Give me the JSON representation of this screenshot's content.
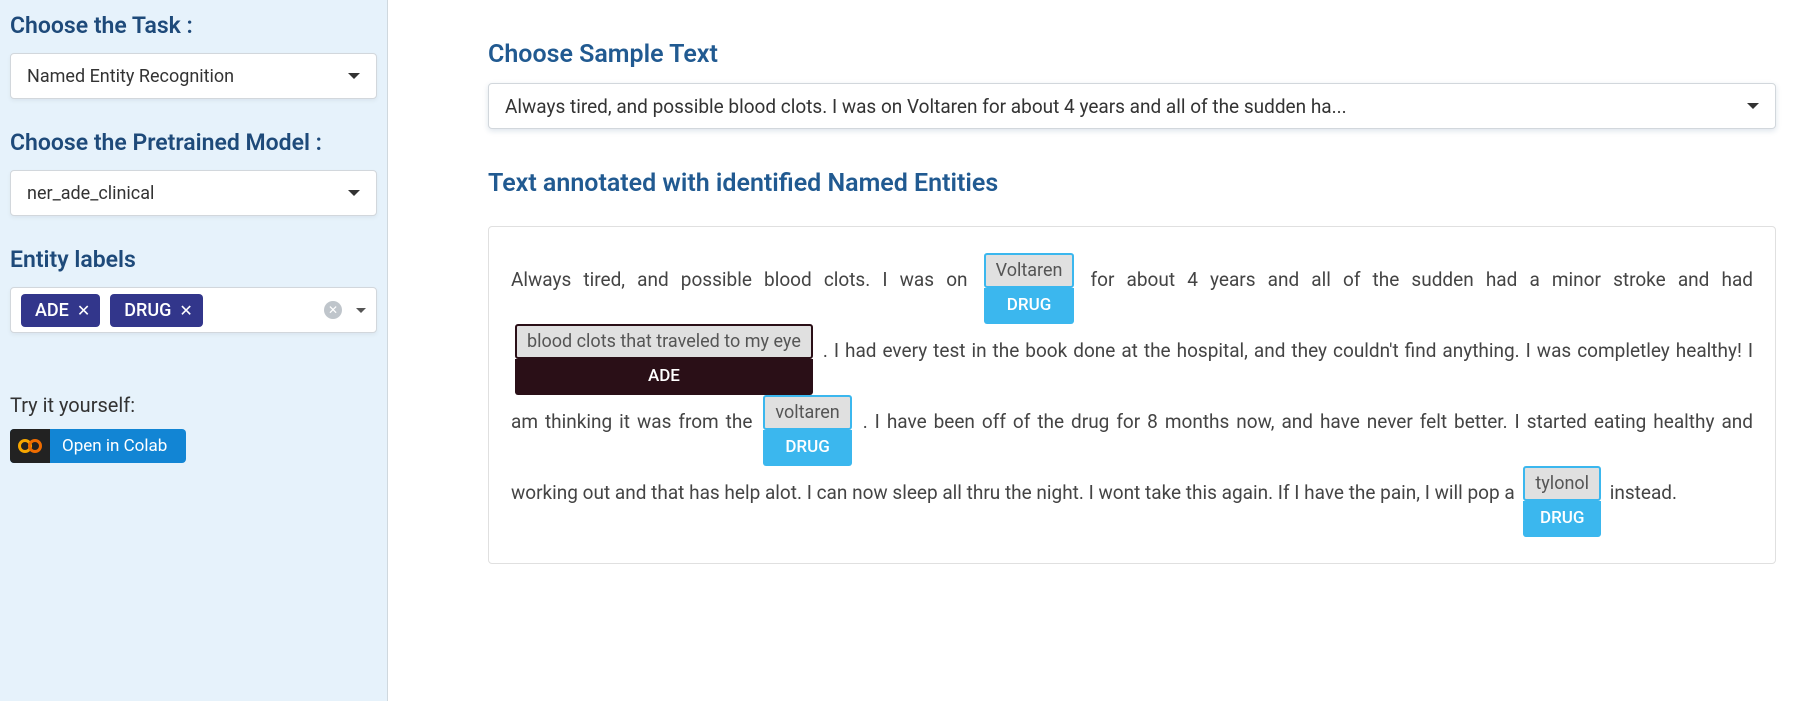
{
  "sidebar": {
    "task_label": "Choose the Task :",
    "task_value": "Named Entity Recognition",
    "model_label": "Choose the Pretrained Model :",
    "model_value": "ner_ade_clinical",
    "entity_label": "Entity labels",
    "tags": [
      "ADE",
      "DRUG"
    ],
    "try_label": "Try it yourself:",
    "colab_label": "Open in Colab"
  },
  "main": {
    "sample_heading": "Choose Sample Text",
    "sample_value": "Always tired, and possible blood clots. I was on Voltaren for about 4 years and all of the sudden ha...",
    "anno_heading": "Text annotated with identified Named Entities",
    "segments": [
      {
        "t": "text",
        "v": "Always tired, and possible blood clots. I was on "
      },
      {
        "t": "entity",
        "kind": "drug",
        "text": "Voltaren",
        "label": "DRUG"
      },
      {
        "t": "text",
        "v": " for about 4 years and all of the sudden had a minor stroke and had "
      },
      {
        "t": "entity",
        "kind": "ade",
        "text": "blood clots that traveled to my eye",
        "label": "ADE"
      },
      {
        "t": "text",
        "v": " . I had every test in the book done at the hospital, and they couldn't find anything. I was completley healthy! I am thinking it was from the "
      },
      {
        "t": "entity",
        "kind": "drug",
        "text": "voltaren",
        "label": "DRUG"
      },
      {
        "t": "text",
        "v": " . I have been off of the drug for 8 months now, and have never felt better. I started eating healthy and working out and that has help alot. I can now sleep all thru the night. I wont take this again. If I have the pain, I will pop a "
      },
      {
        "t": "entity",
        "kind": "drug",
        "text": "tylonol",
        "label": "DRUG"
      },
      {
        "t": "text",
        "v": " instead."
      }
    ]
  }
}
